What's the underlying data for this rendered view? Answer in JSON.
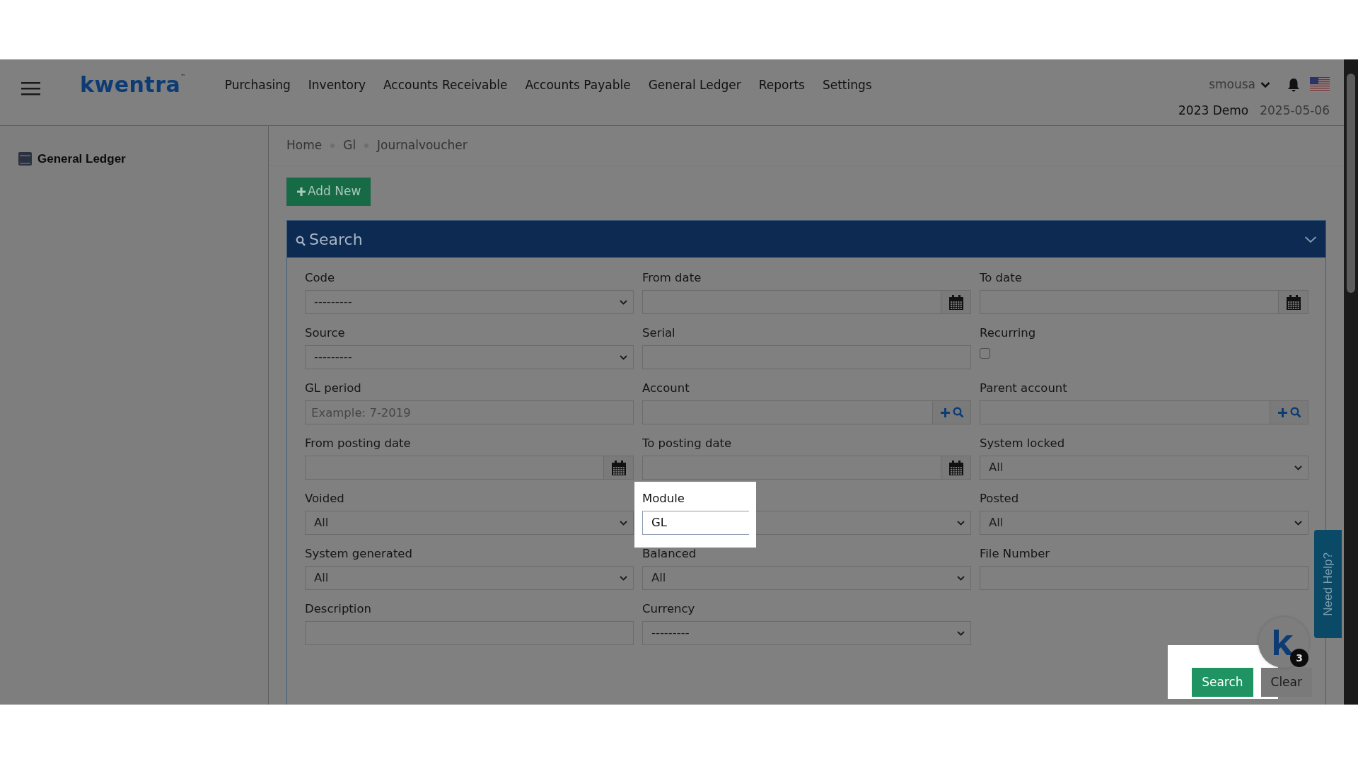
{
  "navbar": {
    "brand": "kwentra",
    "trademark": "™",
    "items": [
      {
        "label": "Purchasing"
      },
      {
        "label": "Inventory"
      },
      {
        "label": "Accounts Receivable"
      },
      {
        "label": "Accounts Payable"
      },
      {
        "label": "General Ledger"
      },
      {
        "label": "Reports"
      },
      {
        "label": "Settings"
      }
    ],
    "user": "smousa",
    "company": "2023 Demo",
    "date": "2025-05-06"
  },
  "sidebar": {
    "items": [
      {
        "label": "General Ledger"
      }
    ]
  },
  "breadcrumb": [
    "Home",
    "Gl",
    "Journalvoucher"
  ],
  "add_button": "Add New",
  "search_panel": {
    "title": "Search",
    "fields": [
      {
        "label": "Code",
        "kind": "select",
        "value": "---------",
        "highlighted": false
      },
      {
        "label": "From date",
        "kind": "date",
        "highlighted": false
      },
      {
        "label": "To date",
        "kind": "date",
        "highlighted": false
      },
      {
        "label": "Source",
        "kind": "select",
        "value": "---------",
        "highlighted": false
      },
      {
        "label": "Serial",
        "kind": "text",
        "highlighted": false
      },
      {
        "label": "Recurring",
        "kind": "checkbox",
        "checked": false,
        "highlighted": false
      },
      {
        "label": "GL period",
        "kind": "text",
        "placeholder": "Example: 7-2019",
        "highlighted": false
      },
      {
        "label": "Account",
        "kind": "lookup",
        "highlighted": false
      },
      {
        "label": "Parent account",
        "kind": "lookup",
        "highlighted": false
      },
      {
        "label": "From posting date",
        "kind": "date",
        "highlighted": false
      },
      {
        "label": "To posting date",
        "kind": "date",
        "highlighted": false
      },
      {
        "label": "System locked",
        "kind": "select",
        "value": "All",
        "highlighted": false
      },
      {
        "label": "Voided",
        "kind": "select",
        "value": "All",
        "highlighted": false
      },
      {
        "label": "Module",
        "kind": "select",
        "value": "GL",
        "highlighted": true
      },
      {
        "label": "Posted",
        "kind": "select",
        "value": "All",
        "highlighted": false
      },
      {
        "label": "System generated",
        "kind": "select",
        "value": "All",
        "highlighted": false
      },
      {
        "label": "Balanced",
        "kind": "select",
        "value": "All",
        "highlighted": false
      },
      {
        "label": "File Number",
        "kind": "text",
        "highlighted": false
      },
      {
        "label": "Description",
        "kind": "text",
        "highlighted": false
      },
      {
        "label": "Currency",
        "kind": "select",
        "value": "---------",
        "highlighted": false
      }
    ],
    "buttons": [
      {
        "label": "Search",
        "kind": "primary",
        "highlighted": true
      },
      {
        "label": "Clear",
        "kind": "secondary",
        "highlighted": false
      }
    ]
  },
  "help_tab": "Need Help?",
  "chat_badge": "3"
}
